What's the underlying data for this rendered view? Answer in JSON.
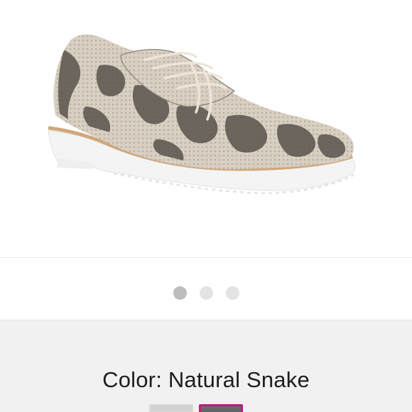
{
  "product": {
    "image_alt": "Natural snake print lace-up oxford shoe with white lug sole"
  },
  "carousel": {
    "slides": 3,
    "active_index": 0
  },
  "variant": {
    "color_prefix": "Color:",
    "color_name": "Natural Snake",
    "swatches": [
      {
        "id": "swatch-silver",
        "selected": false
      },
      {
        "id": "swatch-natural-snake",
        "selected": true
      }
    ]
  },
  "colors": {
    "selected_swatch_border": "#c2187a",
    "active_dot": "#bdbdbd",
    "inactive_dot": "#e3e3e3",
    "panel_background": "#f1f1f1"
  }
}
